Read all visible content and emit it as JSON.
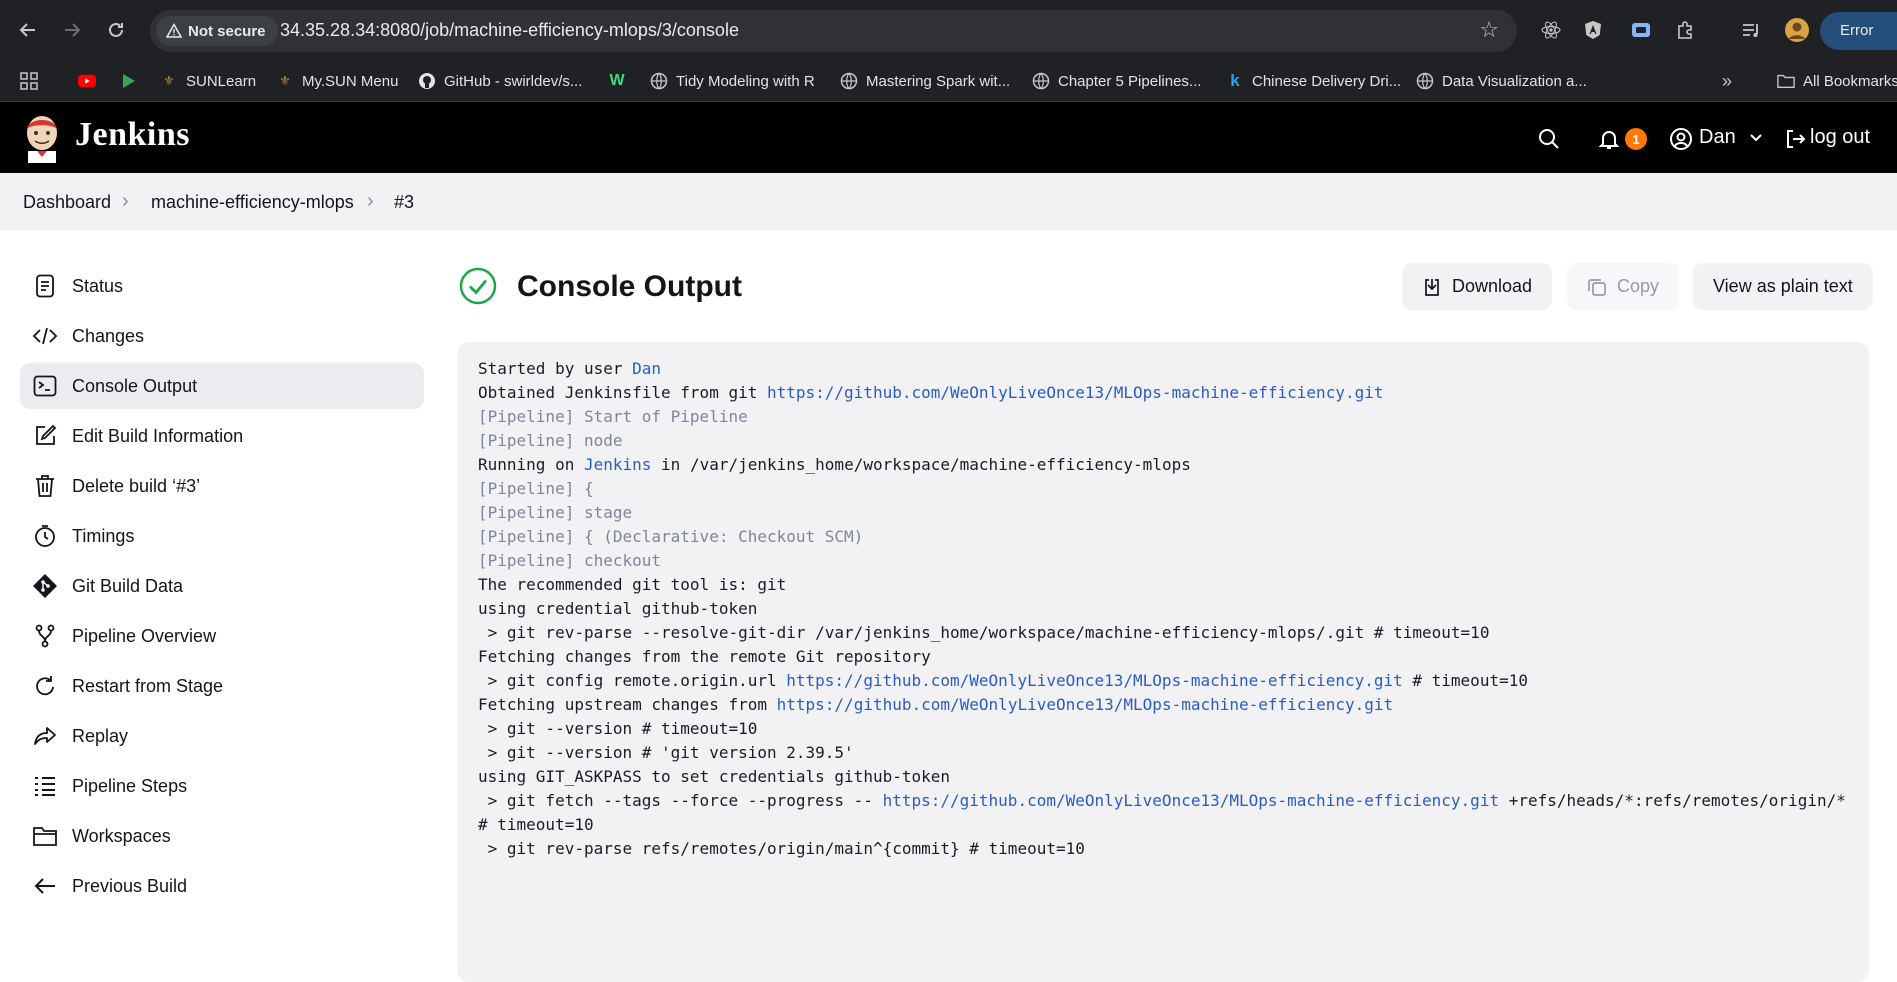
{
  "browser": {
    "security_label": "Not secure",
    "url": "34.35.28.34:8080/job/machine-efficiency-mlops/3/console",
    "profile_status": "Error",
    "bookmarks": [
      {
        "label": "",
        "icon": "youtube-icon"
      },
      {
        "label": "",
        "icon": "play-icon"
      },
      {
        "label": "SUNLearn",
        "icon": "sun-icon"
      },
      {
        "label": "My.SUN Menu",
        "icon": "sun-icon"
      },
      {
        "label": "GitHub - swirldev/s...",
        "icon": "github-icon"
      },
      {
        "label": "",
        "icon": "w-icon"
      },
      {
        "label": "Tidy Modeling with R",
        "icon": "globe-icon"
      },
      {
        "label": "Mastering Spark wit...",
        "icon": "globe-icon"
      },
      {
        "label": "Chapter 5 Pipelines...",
        "icon": "globe-icon"
      },
      {
        "label": "Chinese Delivery Dri...",
        "icon": "k-icon"
      },
      {
        "label": "Data Visualization a...",
        "icon": "globe-icon"
      }
    ],
    "all_bookmarks": "All Bookmarks"
  },
  "header": {
    "app_name": "Jenkins",
    "notification_count": "1",
    "user": "Dan",
    "logout": "log out"
  },
  "breadcrumb": [
    "Dashboard",
    "machine-efficiency-mlops",
    "#3"
  ],
  "sidebar": {
    "items": [
      {
        "label": "Status",
        "icon": "document-icon"
      },
      {
        "label": "Changes",
        "icon": "code-icon"
      },
      {
        "label": "Console Output",
        "icon": "terminal-icon",
        "active": true
      },
      {
        "label": "Edit Build Information",
        "icon": "edit-icon"
      },
      {
        "label": "Delete build ‘#3’",
        "icon": "trash-icon"
      },
      {
        "label": "Timings",
        "icon": "timer-icon"
      },
      {
        "label": "Git Build Data",
        "icon": "git-icon"
      },
      {
        "label": "Pipeline Overview",
        "icon": "branch-icon"
      },
      {
        "label": "Restart from Stage",
        "icon": "restart-icon"
      },
      {
        "label": "Replay",
        "icon": "replay-icon"
      },
      {
        "label": "Pipeline Steps",
        "icon": "list-icon"
      },
      {
        "label": "Workspaces",
        "icon": "folder-icon"
      },
      {
        "label": "Previous Build",
        "icon": "arrow-left-icon"
      }
    ]
  },
  "main": {
    "title": "Console Output",
    "buttons": {
      "download": "Download",
      "copy": "Copy",
      "plain_text": "View as plain text"
    },
    "colors": {
      "success": "#1ea64b",
      "link": "#2a5cc7",
      "pipeline_gray": "#7d869d"
    },
    "console_lines": [
      {
        "kind": "text",
        "parts": [
          {
            "t": "Started by user "
          },
          {
            "t": "Dan",
            "link": true
          }
        ]
      },
      {
        "kind": "text",
        "parts": [
          {
            "t": "Obtained Jenkinsfile from git "
          },
          {
            "t": "https://github.com/WeOnlyLiveOnce13/MLOps-machine-efficiency.git",
            "link": true
          }
        ]
      },
      {
        "kind": "pipe",
        "parts": [
          {
            "t": "[Pipeline] Start of Pipeline"
          }
        ]
      },
      {
        "kind": "pipe",
        "parts": [
          {
            "t": "[Pipeline] node"
          }
        ]
      },
      {
        "kind": "text",
        "parts": [
          {
            "t": "Running on "
          },
          {
            "t": "Jenkins",
            "link": true
          },
          {
            "t": " in /var/jenkins_home/workspace/machine-efficiency-mlops"
          }
        ]
      },
      {
        "kind": "pipe",
        "parts": [
          {
            "t": "[Pipeline] {"
          }
        ]
      },
      {
        "kind": "pipe",
        "parts": [
          {
            "t": "[Pipeline] stage"
          }
        ]
      },
      {
        "kind": "pipe",
        "parts": [
          {
            "t": "[Pipeline] { (Declarative: Checkout SCM)"
          }
        ]
      },
      {
        "kind": "pipe",
        "parts": [
          {
            "t": "[Pipeline] checkout"
          }
        ]
      },
      {
        "kind": "text",
        "parts": [
          {
            "t": "The recommended git tool is: git"
          }
        ]
      },
      {
        "kind": "text",
        "parts": [
          {
            "t": "using credential github-token"
          }
        ]
      },
      {
        "kind": "text",
        "parts": [
          {
            "t": " > git rev-parse --resolve-git-dir /var/jenkins_home/workspace/machine-efficiency-mlops/.git # timeout=10"
          }
        ]
      },
      {
        "kind": "text",
        "parts": [
          {
            "t": "Fetching changes from the remote Git repository"
          }
        ]
      },
      {
        "kind": "text",
        "parts": [
          {
            "t": " > git config remote.origin.url "
          },
          {
            "t": "https://github.com/WeOnlyLiveOnce13/MLOps-machine-efficiency.git",
            "link": true
          },
          {
            "t": " # timeout=10"
          }
        ]
      },
      {
        "kind": "text",
        "parts": [
          {
            "t": "Fetching upstream changes from "
          },
          {
            "t": "https://github.com/WeOnlyLiveOnce13/MLOps-machine-efficiency.git",
            "link": true
          }
        ]
      },
      {
        "kind": "text",
        "parts": [
          {
            "t": " > git --version # timeout=10"
          }
        ]
      },
      {
        "kind": "text",
        "parts": [
          {
            "t": " > git --version # 'git version 2.39.5'"
          }
        ]
      },
      {
        "kind": "text",
        "parts": [
          {
            "t": "using GIT_ASKPASS to set credentials github-token"
          }
        ]
      },
      {
        "kind": "text",
        "parts": [
          {
            "t": " > git fetch --tags --force --progress -- "
          },
          {
            "t": "https://github.com/WeOnlyLiveOnce13/MLOps-machine-efficiency.git",
            "link": true
          },
          {
            "t": " +refs/heads/*:refs/remotes/origin/*"
          }
        ]
      },
      {
        "kind": "text",
        "parts": [
          {
            "t": "# timeout=10"
          }
        ]
      },
      {
        "kind": "text",
        "parts": [
          {
            "t": " > git rev-parse refs/remotes/origin/main^{commit} # timeout=10"
          }
        ]
      }
    ]
  }
}
